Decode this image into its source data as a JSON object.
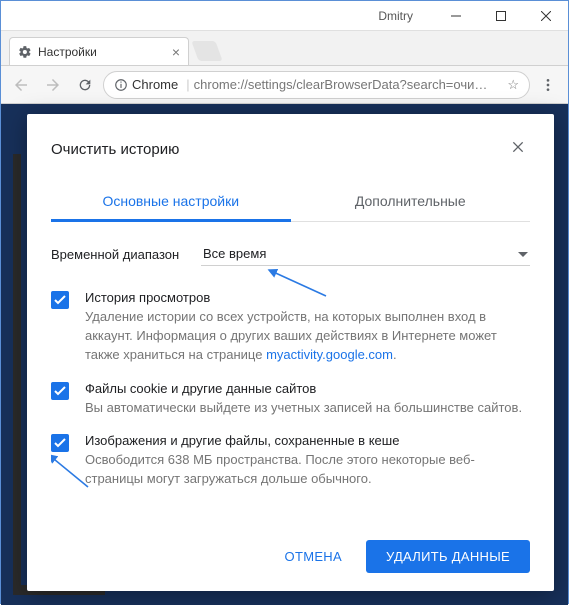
{
  "window": {
    "user": "Dmitry"
  },
  "tab": {
    "title": "Настройки"
  },
  "omnibox": {
    "scheme_label": "Chrome",
    "url": "chrome://settings/clearBrowserData?search=очи…"
  },
  "dialog": {
    "title": "Очистить историю",
    "tabs": {
      "basic": "Основные настройки",
      "advanced": "Дополнительные"
    },
    "range": {
      "label": "Временной диапазон",
      "value": "Все время"
    },
    "items": [
      {
        "title": "История просмотров",
        "desc_pre": "Удаление истории со всех устройств, на которых выполнен вход в аккаунт. Информация о других ваших действиях в Интернете может также храниться на странице ",
        "link": "myactivity.google.com",
        "desc_post": "."
      },
      {
        "title": "Файлы cookie и другие данные сайтов",
        "desc_pre": "Вы автоматически выйдете из учетных записей на большинстве сайтов.",
        "link": "",
        "desc_post": ""
      },
      {
        "title": "Изображения и другие файлы, сохраненные в кеше",
        "desc_pre": "Освободится 638 МБ пространства. После этого некоторые веб-страницы могут загружаться дольше обычного.",
        "link": "",
        "desc_post": ""
      }
    ],
    "buttons": {
      "cancel": "ОТМЕНА",
      "confirm": "УДАЛИТЬ ДАННЫЕ"
    }
  }
}
